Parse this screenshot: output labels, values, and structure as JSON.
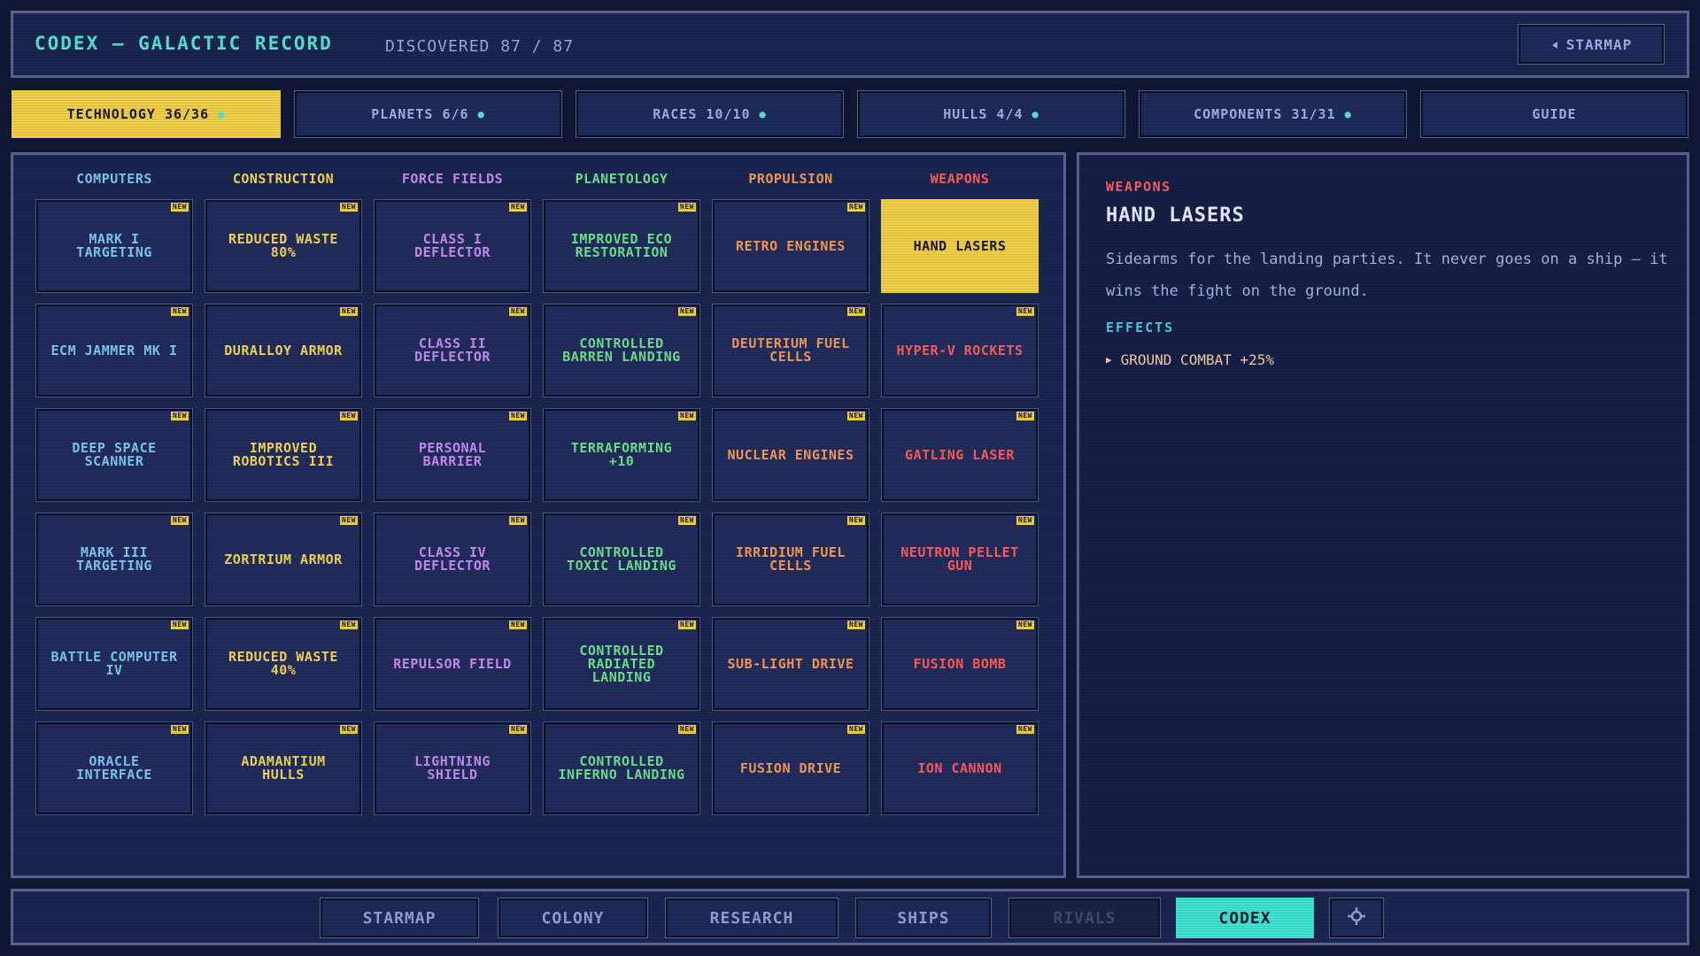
{
  "header": {
    "title": "CODEX — GALACTIC RECORD",
    "discovered": "DISCOVERED 87 / 87",
    "starmap_button": "STARMAP"
  },
  "tabs": [
    {
      "label": "TECHNOLOGY 36/36",
      "active": true,
      "dot": true
    },
    {
      "label": "PLANETS 6/6",
      "active": false,
      "dot": true
    },
    {
      "label": "RACES 10/10",
      "active": false,
      "dot": true
    },
    {
      "label": "HULLS 4/4",
      "active": false,
      "dot": true
    },
    {
      "label": "COMPONENTS 31/31",
      "active": false,
      "dot": true
    },
    {
      "label": "GUIDE",
      "active": false,
      "dot": false
    }
  ],
  "badge_text": "NEW",
  "columns": [
    {
      "label": "COMPUTERS",
      "color": "#7fc6f2",
      "items": [
        "MARK I TARGETING",
        "ECM JAMMER MK I",
        "DEEP SPACE SCANNER",
        "MARK III TARGETING",
        "BATTLE COMPUTER IV",
        "ORACLE INTERFACE"
      ]
    },
    {
      "label": "CONSTRUCTION",
      "color": "#f1d55a",
      "items": [
        "REDUCED WASTE 80%",
        "DURALLOY ARMOR",
        "IMPROVED ROBOTICS III",
        "ZORTRIUM ARMOR",
        "REDUCED WASTE 40%",
        "ADAMANTIUM HULLS"
      ]
    },
    {
      "label": "FORCE FIELDS",
      "color": "#c48cf0",
      "items": [
        "CLASS I DEFLECTOR",
        "CLASS II DEFLECTOR",
        "PERSONAL BARRIER",
        "CLASS IV DEFLECTOR",
        "REPULSOR FIELD",
        "LIGHTNING SHIELD"
      ]
    },
    {
      "label": "PLANETOLOGY",
      "color": "#6fe08c",
      "items": [
        "IMPROVED ECO RESTORATION",
        "CONTROLLED BARREN LANDING",
        "TERRAFORMING +10",
        "CONTROLLED TOXIC LANDING",
        "CONTROLLED RADIATED LANDING",
        "CONTROLLED INFERNO LANDING"
      ]
    },
    {
      "label": "PROPULSION",
      "color": "#f29a5a",
      "items": [
        "RETRO ENGINES",
        "DEUTERIUM FUEL CELLS",
        "NUCLEAR ENGINES",
        "IRRIDIUM FUEL CELLS",
        "SUB-LIGHT DRIVE",
        "FUSION DRIVE"
      ]
    },
    {
      "label": "WEAPONS",
      "color": "#ff5b5b",
      "items": [
        "HAND LASERS",
        "HYPER-V ROCKETS",
        "GATLING LASER",
        "NEUTRON PELLET GUN",
        "FUSION BOMB",
        "ION CANNON"
      ]
    }
  ],
  "selected": {
    "column": 5,
    "row": 0
  },
  "detail": {
    "category": "WEAPONS",
    "title": "HAND LASERS",
    "description": "Sidearms for the landing parties. It never goes on a ship — it wins the fight on the ground.",
    "effects_heading": "EFFECTS",
    "effects": [
      "GROUND COMBAT +25%"
    ]
  },
  "bottom_nav": [
    {
      "label": "STARMAP",
      "state": "normal"
    },
    {
      "label": "COLONY",
      "state": "normal"
    },
    {
      "label": "RESEARCH",
      "state": "normal"
    },
    {
      "label": "SHIPS",
      "state": "normal"
    },
    {
      "label": "RIVALS",
      "state": "disabled"
    },
    {
      "label": "CODEX",
      "state": "active"
    },
    {
      "label": "",
      "state": "normal",
      "icon": "crosshair-icon"
    }
  ]
}
